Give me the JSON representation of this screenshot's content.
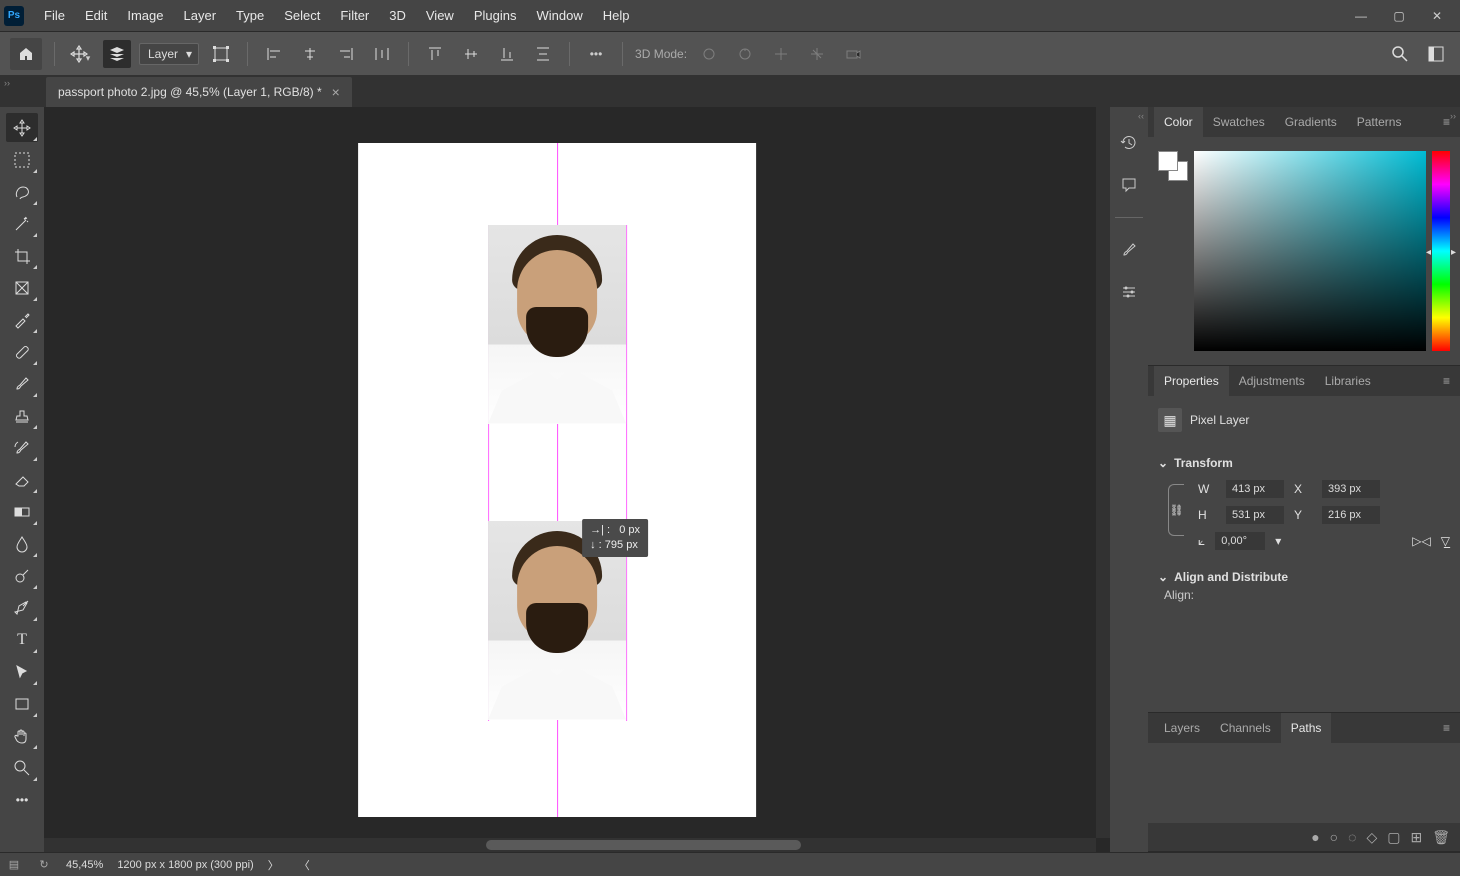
{
  "menubar": {
    "items": [
      "File",
      "Edit",
      "Image",
      "Layer",
      "Type",
      "Select",
      "Filter",
      "3D",
      "View",
      "Plugins",
      "Window",
      "Help"
    ]
  },
  "options": {
    "layer_select": "Layer",
    "mode_3d_label": "3D Mode:"
  },
  "document": {
    "tab_title": "passport photo 2.jpg @ 45,5% (Layer 1, RGB/8) *"
  },
  "move_feedback": {
    "dx_label": "→| :",
    "dx_value": "0 px",
    "dy_label": "↓ :",
    "dy_value": "795 px"
  },
  "panels": {
    "color": {
      "tabs": [
        "Color",
        "Swatches",
        "Gradients",
        "Patterns"
      ],
      "active": 0
    },
    "properties": {
      "tabs": [
        "Properties",
        "Adjustments",
        "Libraries"
      ],
      "active": 0,
      "type_label": "Pixel Layer",
      "transform_label": "Transform",
      "w_label": "W",
      "w_value": "413 px",
      "x_label": "X",
      "x_value": "393 px",
      "h_label": "H",
      "h_value": "531 px",
      "y_label": "Y",
      "y_value": "216 px",
      "angle_value": "0,00°",
      "align_label": "Align and Distribute",
      "align_sub": "Align:"
    },
    "layers": {
      "tabs": [
        "Layers",
        "Channels",
        "Paths"
      ],
      "active": 2
    }
  },
  "status": {
    "zoom": "45,45%",
    "dims": "1200 px x 1800 px (300 ppi)"
  }
}
